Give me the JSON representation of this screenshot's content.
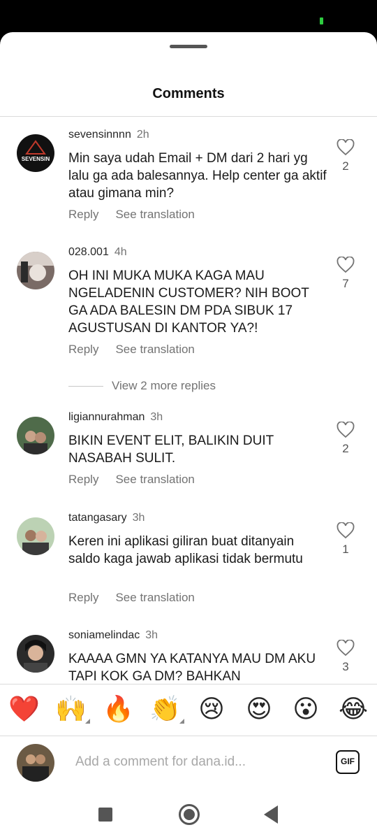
{
  "header": {
    "title": "Comments"
  },
  "comments": [
    {
      "username": "sevensinnnn",
      "time": "2h",
      "text": "Min saya udah Email + DM dari 2 hari yg lalu ga ada balesannya. Help center ga aktif atau gimana min?",
      "reply_label": "Reply",
      "translate_label": "See translation",
      "likes": "2",
      "avatar_text": "SEVENSIN"
    },
    {
      "username": "028.001",
      "time": "4h",
      "text": "OH INI MUKA MUKA KAGA MAU NGELADENIN CUSTOMER? NIH BOOT GA ADA BALESIN DM PDA SIBUK 17 AGUSTUSAN DI KANTOR YA?!",
      "reply_label": "Reply",
      "translate_label": "See translation",
      "likes": "7"
    },
    {
      "username": "ligiannurahman",
      "time": "3h",
      "text": "BIKIN EVENT ELIT, BALIKIN DUIT NASABAH SULIT.",
      "reply_label": "Reply",
      "translate_label": "See translation",
      "likes": "2"
    },
    {
      "username": "tatangasary",
      "time": "3h",
      "text": "Keren ini aplikasi giliran buat ditanyain saldo kaga jawab aplikasi tidak bermutu",
      "reply_label": "Reply",
      "translate_label": "See translation",
      "likes": "1"
    },
    {
      "username": "soniamelindac",
      "time": "3h",
      "text": "KAAAA GMN YA KATANYA MAU DM AKU TAPI KOK GA DM? BAHKAN",
      "likes": "3"
    }
  ],
  "more_replies": "View 2 more replies",
  "emoji_bar": [
    {
      "glyph": "❤️",
      "name": "heart-emoji"
    },
    {
      "glyph": "🙌",
      "name": "raising-hands-emoji"
    },
    {
      "glyph": "🔥",
      "name": "fire-emoji"
    },
    {
      "glyph": "👏",
      "name": "clapping-emoji"
    },
    {
      "glyph": "😢",
      "name": "crying-emoji"
    },
    {
      "glyph": "😍",
      "name": "heart-eyes-emoji"
    },
    {
      "glyph": "😮",
      "name": "surprised-emoji"
    },
    {
      "glyph": "😂",
      "name": "tears-of-joy-emoji"
    }
  ],
  "composer": {
    "placeholder": "Add a comment for dana.id...",
    "gif_label": "GIF"
  },
  "colors": {
    "accent_text": "#262626",
    "muted_text": "#737373",
    "status_green": "#2ecc40"
  }
}
